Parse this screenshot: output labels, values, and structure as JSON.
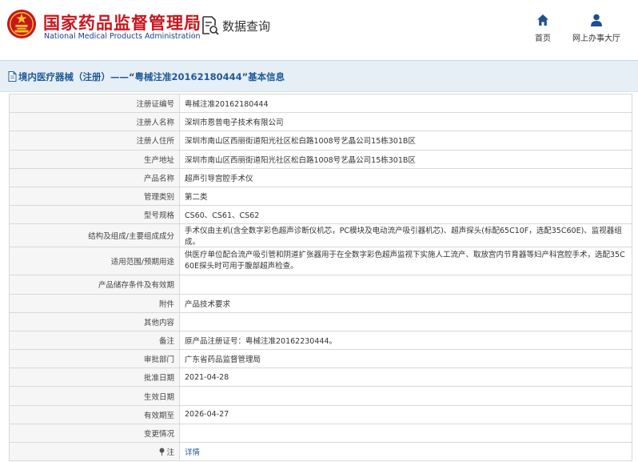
{
  "header": {
    "brand_cn": "国家药品监督管理局",
    "brand_en": "National Medical Products Administration",
    "page_name": "数据查询",
    "colors": {
      "brand_red": "#c8161d",
      "brand_blue": "#1a3f8a",
      "title_blue": "#1f5a96"
    },
    "nav": [
      {
        "label": "首页",
        "icon": "home-icon"
      },
      {
        "label": "网上办事大厅",
        "icon": "user-icon"
      }
    ]
  },
  "title_bar": {
    "text": "境内医疗器械（注册）——“粤械注准20162180444”基本信息",
    "icon": "document-icon"
  },
  "rows": [
    {
      "key": "注册证编号",
      "value": "粤械注准20162180444"
    },
    {
      "key": "注册人名称",
      "value": "深圳市恩普电子技术有限公司"
    },
    {
      "key": "注册人住所",
      "value": "深圳市南山区西丽街道阳光社区松白路1008号艺晶公司15栋301B区"
    },
    {
      "key": "生产地址",
      "value": "深圳市南山区西丽街道阳光社区松白路1008号艺晶公司15栋301B区"
    },
    {
      "key": "产品名称",
      "value": "超声引导宫腔手术仪"
    },
    {
      "key": "管理类别",
      "value": "第二类"
    },
    {
      "key": "型号规格",
      "value": "CS60、CS61、CS62"
    },
    {
      "key": "结构及组成/主要组成成分",
      "value": "手术仪由主机(含全数字彩色超声诊断仪机芯，PC模块及电动流产吸引器机芯)、超声探头(标配65C10F，选配35C60E)、监视器组成。"
    },
    {
      "key": "适用范围/预期用途",
      "value": "供医疗单位配合流产吸引管和阴道扩张器用于在全数字彩色超声监视下实施人工流产、取放宫内节育器等妇产科宫腔手术，选配35C60E探头时可用于腹部超声检查。"
    },
    {
      "key": "产品储存条件及有效期",
      "value": ""
    },
    {
      "key": "附件",
      "value": "产品技术要求"
    },
    {
      "key": "其他内容",
      "value": ""
    },
    {
      "key": "备注",
      "value": "原产品注册证号：粤械注准20162230444。"
    },
    {
      "key": "审批部门",
      "value": "广东省药品监督管理局"
    },
    {
      "key": "批准日期",
      "value": "2021-04-28"
    },
    {
      "key": "生效日期",
      "value": ""
    },
    {
      "key": "有效期至",
      "value": "2026-04-27"
    },
    {
      "key": "变更情况",
      "value": ""
    }
  ],
  "note_row": {
    "key": "注",
    "link": "详情",
    "icon": "pin-icon"
  }
}
